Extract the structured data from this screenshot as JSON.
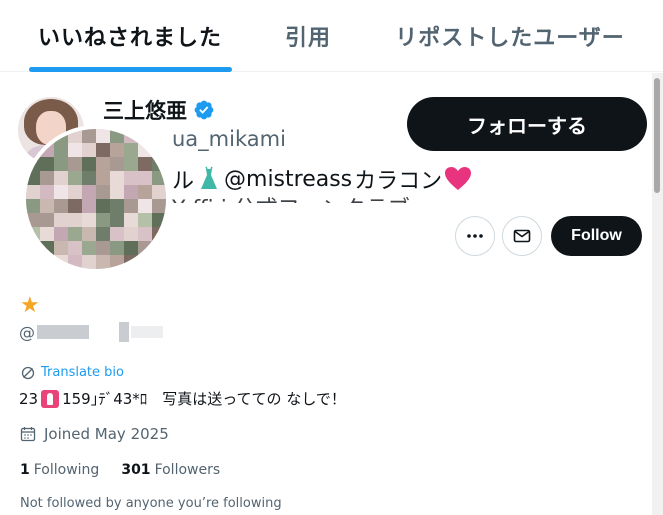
{
  "tabs": [
    {
      "label": "いいねされました",
      "active": true
    },
    {
      "label": "引用",
      "active": false
    },
    {
      "label": "リポストしたユーザー",
      "active": false
    }
  ],
  "accent_color": "#1d9bf0",
  "hover_card": {
    "name": "三上悠亜",
    "handle_fragment": "ua_mikami",
    "bio_line1_prefix": "ル",
    "bio_line1_mention": "@mistreass",
    "bio_line1_suffix": " カラコン",
    "bio_line2": "Y    ffi  i   公式ファンクラブ",
    "follow_label": "フォローする",
    "verified_icon": "verified-badge-icon"
  },
  "profile": {
    "emoji": "★",
    "handle_prefix": "@",
    "translate_label": "Translate bio",
    "bio_age": "23",
    "bio_rest": "159｣ﾃﾞ43*ﾛ　写真は送ってての なしで！",
    "joined": "Joined May 2025",
    "following_count": "1",
    "following_label": "Following",
    "followers_count": "301",
    "followers_label": "Followers",
    "not_followed": "Not followed by anyone you’re following",
    "follow_button": "Follow",
    "more_icon": "more-icon",
    "message_icon": "message-icon"
  }
}
